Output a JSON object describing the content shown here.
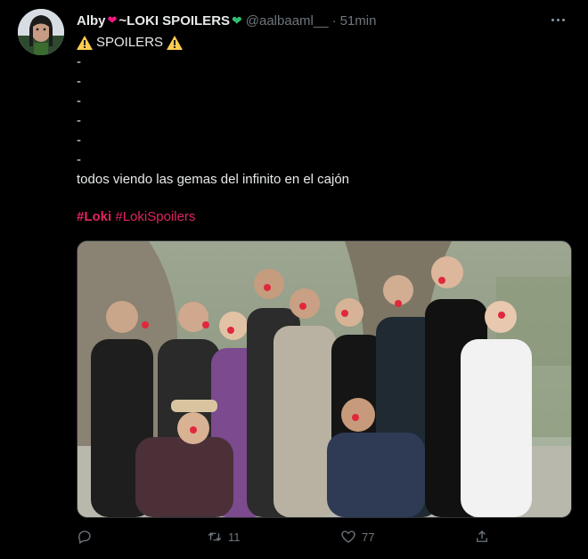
{
  "tweet": {
    "display_name": "Alby",
    "display_name_suffix": "~LOKI SPOILERS",
    "handle": "@aalbaaml__",
    "separator": "·",
    "time": "51min",
    "body": {
      "spoilers": "SPOILERS",
      "dashes": [
        "-",
        "-",
        "-",
        "-",
        "-",
        "-"
      ],
      "sentence": "todos viendo las gemas del infinito en el cajón"
    },
    "hashtags": [
      "#Loki",
      "#LokiSpoilers"
    ]
  },
  "actions": {
    "reply_count": "",
    "retweet_count": "11",
    "like_count": "77"
  },
  "icons": {
    "pink_heart": "heart-with-arrow-icon",
    "green_heart": "green-heart-icon",
    "warning": "warning-icon",
    "more": "more-icon",
    "reply": "reply-icon",
    "retweet": "retweet-icon",
    "like": "like-icon",
    "share": "share-icon"
  },
  "colors": {
    "background": "#000000",
    "text": "#e7e9ea",
    "muted": "#6e767d",
    "hashtag": "#e0245e",
    "warning": "#ffcc4d"
  }
}
